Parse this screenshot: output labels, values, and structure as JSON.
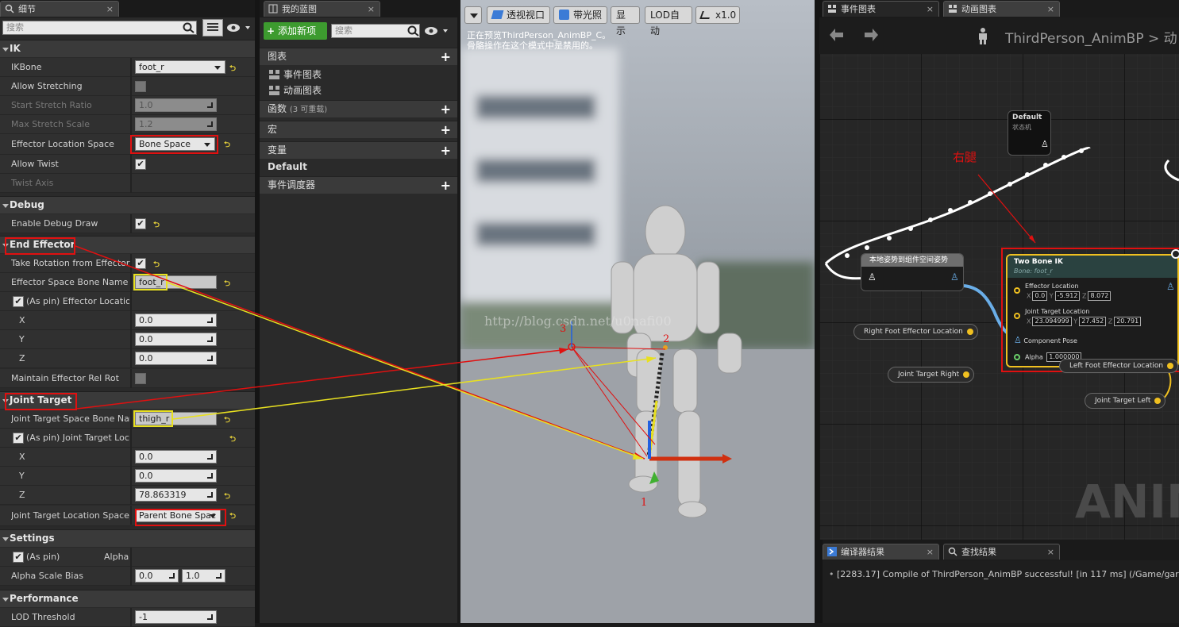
{
  "tabs": {
    "details": "细节",
    "my_blueprint": "我的蓝图",
    "event_graph": "事件图表",
    "anim_graph": "动画图表",
    "compiler_results": "编译器结果",
    "find_results": "查找结果",
    "close": "×"
  },
  "details": {
    "search_placeholder": "搜索",
    "cat_ik": "IK",
    "ik_bone_label": "IKBone",
    "ik_bone_value": "foot_r",
    "allow_stretching": "Allow Stretching",
    "start_stretch_ratio": "Start Stretch Ratio",
    "start_stretch_value": "1.0",
    "max_stretch_scale": "Max Stretch Scale",
    "max_stretch_value": "1.2",
    "effector_location_space": "Effector Location Space",
    "effector_location_space_value": "Bone Space",
    "allow_twist": "Allow Twist",
    "twist_axis": "Twist Axis",
    "cat_debug": "Debug",
    "enable_debug_draw": "Enable Debug Draw",
    "cat_end_effector": "End Effector",
    "take_rotation": "Take Rotation from Effector S",
    "effector_space_bone_name": "Effector Space Bone Name",
    "effector_space_bone_value": "foot_r",
    "as_pin_effector": "(As pin) Effector Locatior",
    "x": "X",
    "y": "Y",
    "z": "Z",
    "effector_x": "0.0",
    "effector_y": "0.0",
    "effector_z": "0.0",
    "maintain_effector": "Maintain Effector Rel Rot",
    "cat_joint_target": "Joint Target",
    "joint_target_space_bone": "Joint Target Space Bone Name",
    "joint_target_space_bone_value": "thigh_r",
    "as_pin_joint": "(As pin) Joint Target Loca",
    "joint_x": "0.0",
    "joint_y": "0.0",
    "joint_z": "78.863319",
    "joint_target_location_space": "Joint Target Location Space",
    "joint_target_location_space_value": "Parent Bone Spac",
    "cat_settings": "Settings",
    "as_pin": "(As pin)",
    "alpha": "Alpha",
    "alpha_scale_bias": "Alpha Scale Bias",
    "alpha_min": "0.0",
    "alpha_max": "1.0",
    "cat_performance": "Performance",
    "lod_threshold": "LOD Threshold",
    "lod_value": "-1"
  },
  "my_blueprint": {
    "add_new": "添加新项",
    "search_placeholder": "搜索",
    "graphs": "图表",
    "event_graph": "事件图表",
    "anim_graph": "动画图表",
    "functions": "函数",
    "functions_count": "(3 可重载)",
    "macros": "宏",
    "variables": "变量",
    "default": "Default",
    "event_dispatchers": "事件调度器"
  },
  "viewport": {
    "perspective": "透视视口",
    "lit": "带光照",
    "show": "显示",
    "lod": "LOD自动",
    "speed": "x1.0",
    "preview_line1": "正在预览ThirdPerson_AnimBP_C。",
    "preview_line2": "骨骼操作在这个模式中是禁用的。",
    "watermark": "http://blog.csdn.net/u0nafi00",
    "label_1": "1",
    "label_2": "2",
    "label_3": "3"
  },
  "graph": {
    "breadcrumb": "ThirdPerson_AnimBP",
    "breadcrumb_sep": ">",
    "breadcrumb_next": "动",
    "annotation_right_leg": "右腿",
    "default_node_title": "Default",
    "default_node_sub": "状态机",
    "local_to_component": "本地姿势到组件空间姿势",
    "two_bone_ik_title": "Two Bone IK",
    "two_bone_ik_bone": "Bone: foot_r",
    "effector_location": "Effector Location",
    "eff_x": "0.0",
    "eff_y": "-5.912",
    "eff_z": "8.072",
    "joint_target_location": "Joint Target Location",
    "jt_x": "23.094999",
    "jt_y": "27.452",
    "jt_z": "20.791",
    "component_pose": "Component Pose",
    "alpha": "Alpha",
    "alpha_value": "1.000000",
    "right_foot_effector": "Right Foot Effector Location",
    "joint_target_right": "Joint Target Right",
    "left_foot_effector": "Left Foot Effector Location",
    "joint_target_left": "Joint Target Left",
    "watermark": "ANIM",
    "axis_x": "X",
    "axis_y": "Y",
    "axis_z": "Z"
  },
  "log": {
    "message": "[2283.17] Compile of ThirdPerson_AnimBP successful! [in 117 ms] (/Game/gar"
  },
  "colors": {
    "annotation_red": "#e01010",
    "annotation_yellow": "#e8e020",
    "add_green": "#3d9b2f",
    "node_gold": "#f0c020"
  }
}
